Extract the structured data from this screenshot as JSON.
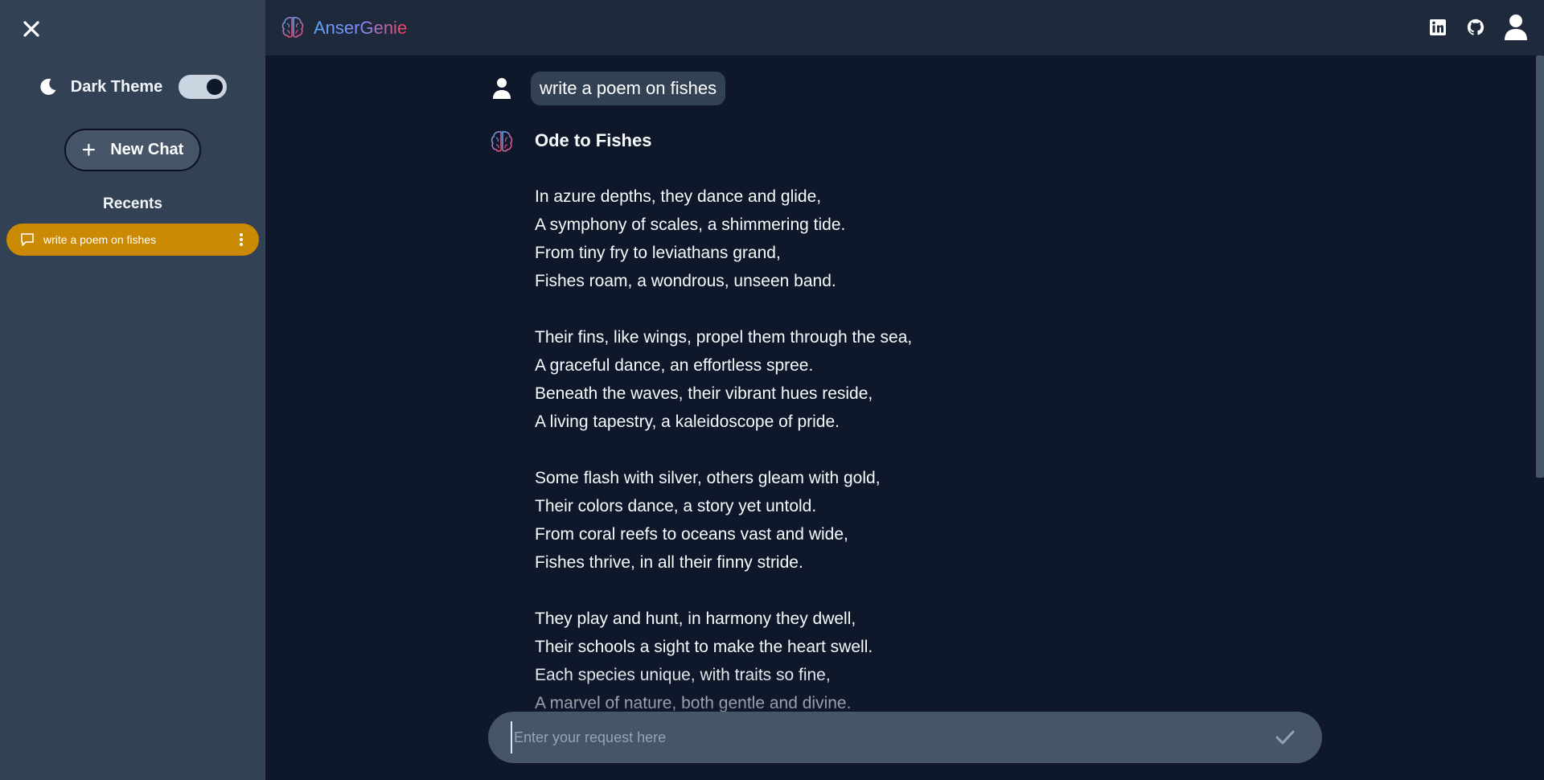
{
  "app": {
    "name": "AnserGenie"
  },
  "colors": {
    "sidebar_bg": "#334155",
    "header_bg": "#1e293b",
    "main_bg": "#0f172a",
    "recent_active": "#ca8a04",
    "input_bg": "#475569"
  },
  "sidebar": {
    "close_icon": "close-icon",
    "theme_icon": "moon-icon",
    "theme_label": "Dark Theme",
    "theme_enabled": true,
    "new_chat_label": "New Chat",
    "recents_title": "Recents",
    "recents": [
      {
        "label": "write a poem on fishes",
        "icon": "chat-bubble-icon",
        "menu_icon": "more-vertical-icon",
        "active": true
      }
    ]
  },
  "header": {
    "icons": [
      "linkedin-icon",
      "github-icon",
      "profile-icon"
    ]
  },
  "chat": {
    "user_message": "write a poem on fishes",
    "assistant": {
      "title": "Ode to Fishes",
      "stanzas": [
        [
          "In azure depths, they dance and glide,",
          "A symphony of scales, a shimmering tide.",
          "From tiny fry to leviathans grand,",
          "Fishes roam, a wondrous, unseen band."
        ],
        [
          "Their fins, like wings, propel them through the sea,",
          "A graceful dance, an effortless spree.",
          "Beneath the waves, their vibrant hues reside,",
          "A living tapestry, a kaleidoscope of pride."
        ],
        [
          "Some flash with silver, others gleam with gold,",
          "Their colors dance, a story yet untold.",
          "From coral reefs to oceans vast and wide,",
          "Fishes thrive, in all their finny stride."
        ],
        [
          "They play and hunt, in harmony they dwell,",
          "Their schools a sight to make the heart swell.",
          "Each species unique, with traits so fine,",
          "A marvel of nature, both gentle and divine."
        ]
      ]
    }
  },
  "input": {
    "placeholder": "Enter your request here",
    "value": "",
    "send_icon": "check-icon"
  }
}
